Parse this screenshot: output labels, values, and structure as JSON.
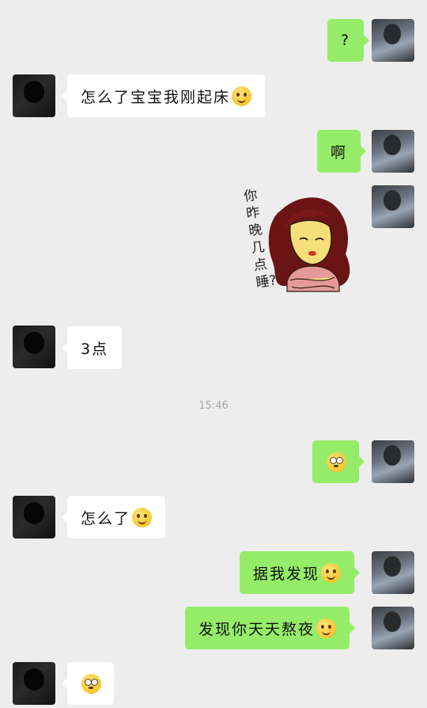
{
  "messages": [
    {
      "from": "me",
      "text": "?"
    },
    {
      "from": "other",
      "text": "怎么了宝宝我刚起床"
    },
    {
      "from": "me",
      "text": "啊"
    },
    {
      "from": "me",
      "sticker": "girl-sticker",
      "sticker_text": "你昨晚几点睡?"
    },
    {
      "from": "other",
      "text": "3点"
    },
    {
      "from": "me",
      "text": ""
    },
    {
      "from": "other",
      "text": "怎么了"
    },
    {
      "from": "me",
      "text": "据我发现"
    },
    {
      "from": "me",
      "text": "发现你天天熬夜"
    },
    {
      "from": "other",
      "text": ""
    }
  ],
  "timestamp": "15:46",
  "icons": {
    "smile": "smiling-face-icon",
    "flushed": "flushed-face-icon"
  },
  "colors": {
    "background": "#ededed",
    "my_bubble": "#95ec69",
    "their_bubble": "#ffffff",
    "timestamp": "#a8a8a8"
  }
}
